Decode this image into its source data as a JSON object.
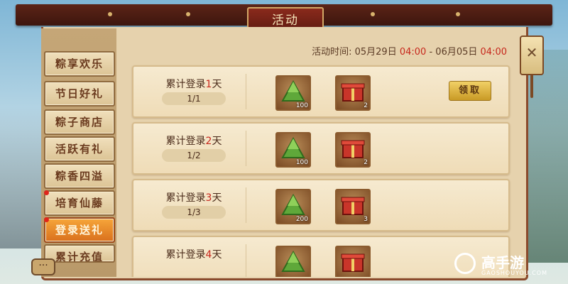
{
  "window": {
    "title": "活动"
  },
  "sidebar": {
    "tabs": [
      {
        "label": "粽享欢乐",
        "active": false,
        "dot": false
      },
      {
        "label": "节日好礼",
        "active": false,
        "dot": false
      },
      {
        "label": "粽子商店",
        "active": false,
        "dot": false
      },
      {
        "label": "活跃有礼",
        "active": false,
        "dot": false
      },
      {
        "label": "粽香四溢",
        "active": false,
        "dot": false
      },
      {
        "label": "培育仙藤",
        "active": false,
        "dot": true
      },
      {
        "label": "登录送礼",
        "active": true,
        "dot": true
      },
      {
        "label": "累计充值",
        "active": false,
        "dot": false
      }
    ]
  },
  "event_time": {
    "label": "活动时间:",
    "start_date": "05月29日",
    "start_time": "04:00",
    "separator": "-",
    "end_date": "06月05日",
    "end_time": "04:00"
  },
  "rows": [
    {
      "label_prefix": "累计登录",
      "days": "1",
      "label_suffix": "天",
      "progress": "1/1",
      "items": [
        {
          "icon": "zongzi-icon",
          "count": "100"
        },
        {
          "icon": "gift-box-icon",
          "count": "2"
        }
      ],
      "claim_label": "领取"
    },
    {
      "label_prefix": "累计登录",
      "days": "2",
      "label_suffix": "天",
      "progress": "1/2",
      "items": [
        {
          "icon": "zongzi-icon",
          "count": "100"
        },
        {
          "icon": "gift-box-icon",
          "count": "2"
        }
      ]
    },
    {
      "label_prefix": "累计登录",
      "days": "3",
      "label_suffix": "天",
      "progress": "1/3",
      "items": [
        {
          "icon": "zongzi-icon",
          "count": "200"
        },
        {
          "icon": "gift-box-icon",
          "count": "3"
        }
      ]
    },
    {
      "label_prefix": "累计登录",
      "days": "4",
      "label_suffix": "天",
      "progress": "",
      "items": [
        {
          "icon": "zongzi-icon",
          "count": ""
        },
        {
          "icon": "gift-box-icon",
          "count": ""
        }
      ]
    }
  ],
  "close_button": {
    "icon": "close-icon",
    "glyph": "✕"
  },
  "chat_button": {
    "icon": "chat-icon",
    "glyph": "···"
  },
  "watermark": {
    "brand": "高手游",
    "url": "GAOSHOUYOU.COM"
  },
  "colors": {
    "accent_red": "#c7271c",
    "active_tab": "#e68a2a",
    "frame_brown": "#8a4a2c"
  }
}
